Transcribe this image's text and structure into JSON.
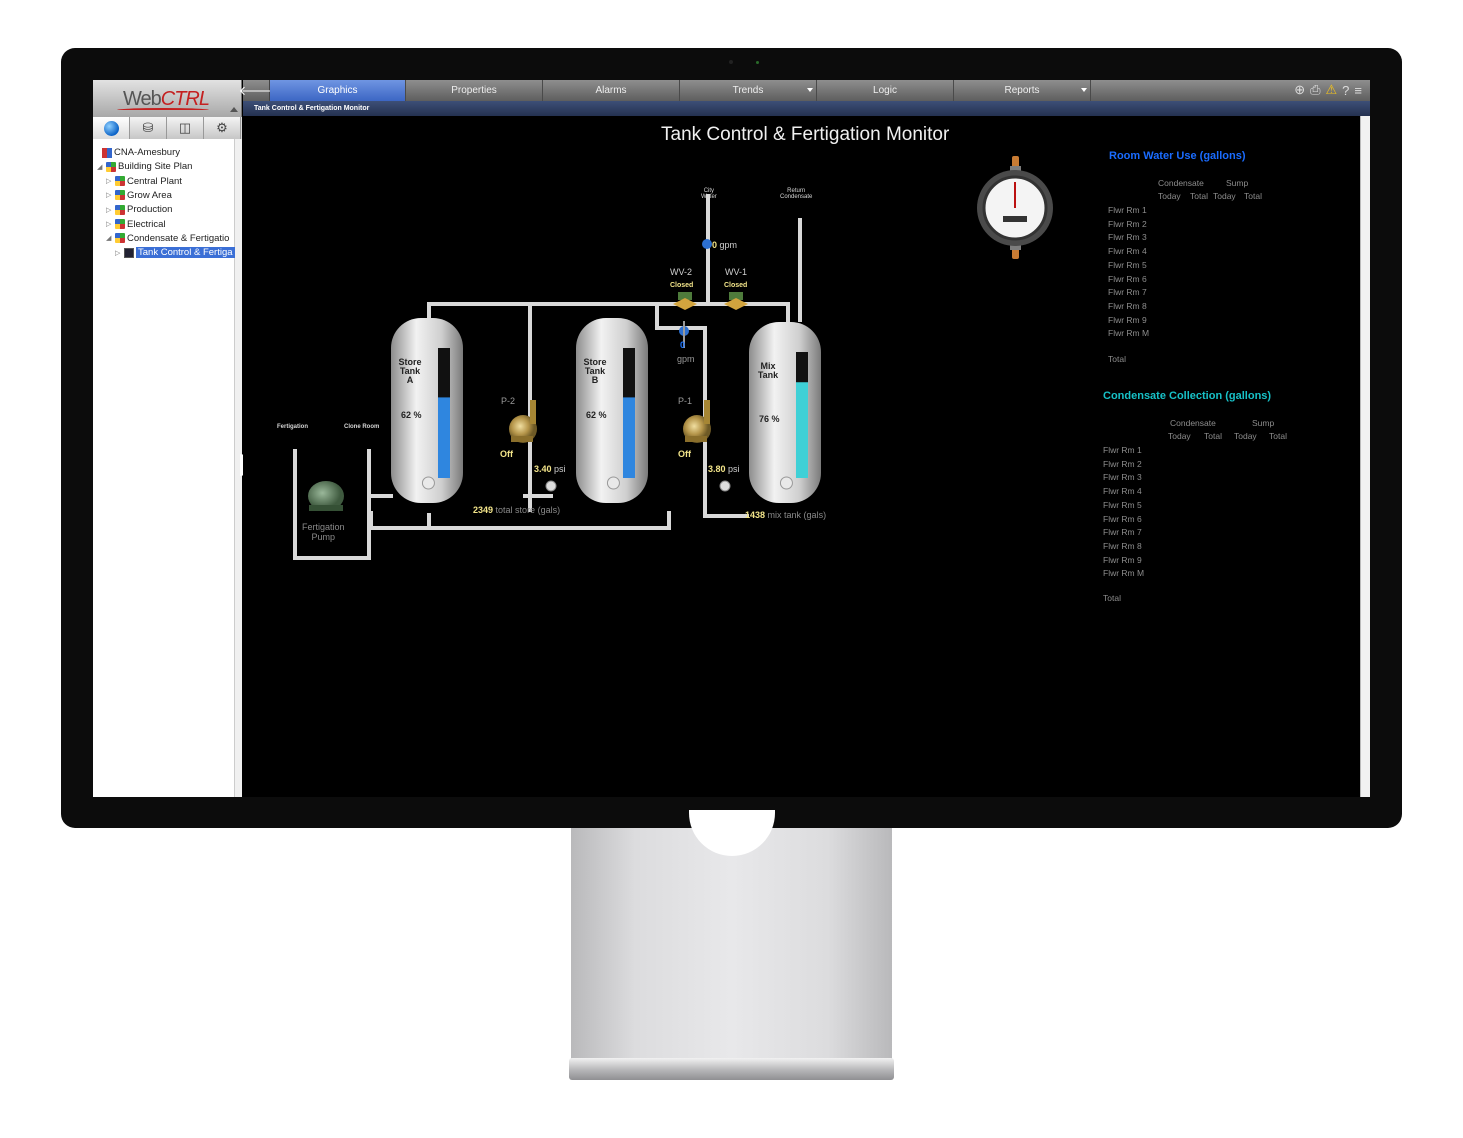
{
  "app": {
    "logo": {
      "web": "Web",
      "ctrl": "CTRL"
    },
    "colors": {
      "selection": "#3b6fd6",
      "tab_active": "#3c66c4",
      "water_title": "#1a6cff",
      "condensate_title": "#17c1c7",
      "value_yellow": "#f3e58a"
    }
  },
  "left_nav": {
    "icons": [
      "globe-icon",
      "network-icon",
      "schedule-icon",
      "config-icon"
    ]
  },
  "tree": [
    {
      "label": "CNA-Amesbury",
      "icon": "root-icon",
      "level": 0
    },
    {
      "label": "Building Site Plan",
      "icon": "building-icon",
      "level": 1
    },
    {
      "label": "Central Plant",
      "icon": "building-icon",
      "level": 2
    },
    {
      "label": "Grow Area",
      "icon": "building-icon",
      "level": 2
    },
    {
      "label": "Production",
      "icon": "building-icon",
      "level": 2
    },
    {
      "label": "Electrical",
      "icon": "building-icon",
      "level": 2
    },
    {
      "label": "Condensate & Fertigatio",
      "icon": "building-icon",
      "level": 2
    },
    {
      "label": "Tank Control & Fertiga",
      "icon": "graphic-icon",
      "level": 3,
      "selected": true
    }
  ],
  "tabs": [
    {
      "label": "Graphics",
      "active": true
    },
    {
      "label": "Properties"
    },
    {
      "label": "Alarms"
    },
    {
      "label": "Trends",
      "dropdown": true
    },
    {
      "label": "Logic"
    },
    {
      "label": "Reports",
      "dropdown": true
    }
  ],
  "toolbar_icons": [
    "network-tools-icon",
    "print-icon",
    "warning-icon",
    "help-icon",
    "menu-icon"
  ],
  "breadcrumb": "Tank Control & Fertigation Monitor",
  "graphic": {
    "title": "Tank Control & Fertigation Monitor",
    "city_water": "City\nWater",
    "return_condensate": "Return\nCondensate",
    "flow_top": {
      "value": "0",
      "unit": "gpm"
    },
    "flow_mid": {
      "value": "0",
      "unit": "gpm"
    },
    "valves": [
      {
        "name": "WV-2",
        "state": "Closed"
      },
      {
        "name": "WV-1",
        "state": "Closed"
      }
    ],
    "tanks": [
      {
        "label": "Store\nTank\nA",
        "percent": "62 %",
        "level": 0.62,
        "color": "#2f86df"
      },
      {
        "label": "Store\nTank\nB",
        "percent": "62 %",
        "level": 0.62,
        "color": "#2f86df"
      },
      {
        "label": "Mix\nTank",
        "percent": "76 %",
        "level": 0.76,
        "color": "#3fd0d6"
      }
    ],
    "pumps": [
      {
        "name": "P-2",
        "state": "Off",
        "pressure": "3.40",
        "unit": "psi"
      },
      {
        "name": "P-1",
        "state": "Off",
        "pressure": "3.80",
        "unit": "psi"
      }
    ],
    "fertigation_label": "Fertigation",
    "clone_room_label": "Clone Room",
    "fertigation_pump": "Fertigation\nPump",
    "total_store": {
      "value": "2349",
      "label": "total store (gals)"
    },
    "mix_tank": {
      "value": "1438",
      "label": "mix tank (gals)"
    }
  },
  "room_water": {
    "title": "Room Water Use (gallons)",
    "group_headers": [
      "Condensate",
      "Sump"
    ],
    "col_headers": [
      "Today",
      "Total",
      "Today",
      "Total"
    ],
    "rows": [
      "Flwr Rm 1",
      "Flwr Rm 2",
      "Flwr Rm 3",
      "Flwr Rm 4",
      "Flwr Rm 5",
      "Flwr Rm 6",
      "Flwr Rm 7",
      "Flwr Rm 8",
      "Flwr Rm 9",
      "Flwr Rm M"
    ],
    "total_label": "Total"
  },
  "condensate_collection": {
    "title": "Condensate Collection (gallons)",
    "group_headers": [
      "Condensate",
      "Sump"
    ],
    "col_headers": [
      "Today",
      "Total",
      "Today",
      "Total"
    ],
    "rows": [
      "Flwr Rm 1",
      "Flwr Rm 2",
      "Flwr Rm 3",
      "Flwr Rm 4",
      "Flwr Rm 5",
      "Flwr Rm 6",
      "Flwr Rm 7",
      "Flwr Rm 8",
      "Flwr Rm 9",
      "Flwr Rm M"
    ],
    "total_label": "Total"
  }
}
